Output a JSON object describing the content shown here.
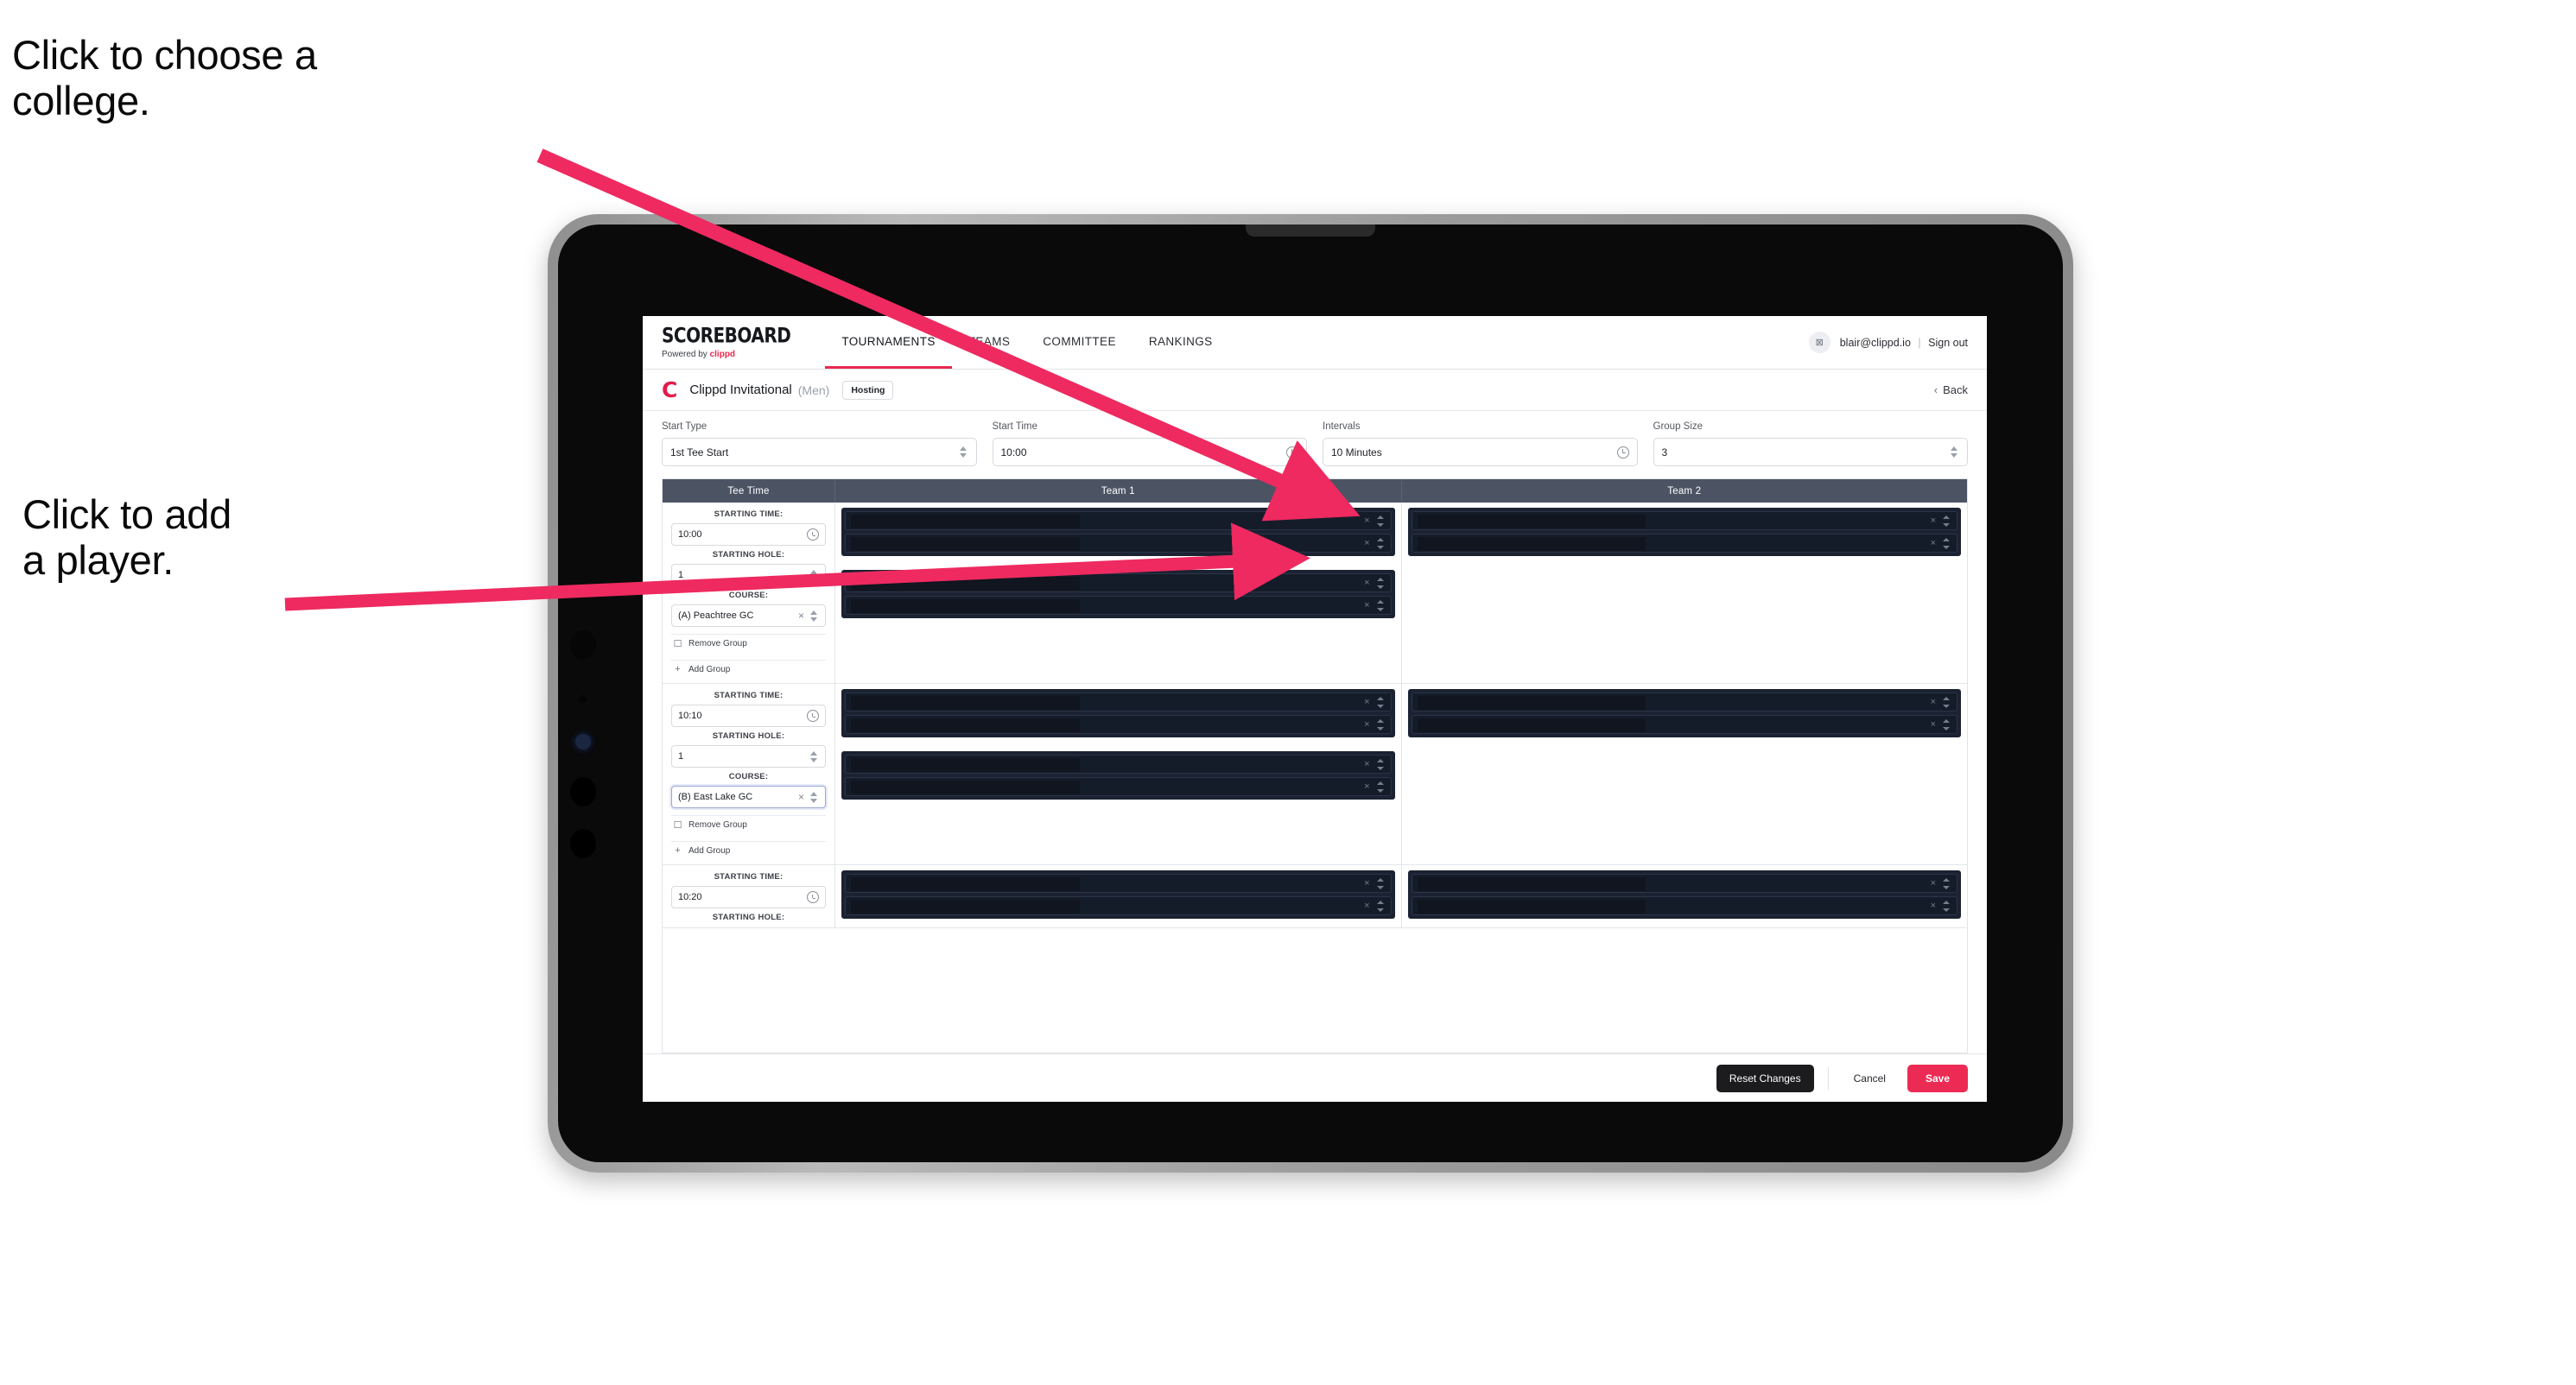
{
  "annotations": [
    {
      "id": "choose-college",
      "text": "Click to choose a\ncollege."
    },
    {
      "id": "add-player",
      "text": "Click to add\na player."
    }
  ],
  "colors": {
    "accent_pink": "#ec2b54",
    "arrow_pink": "#ee2a60",
    "table_header": "#4c5464",
    "redact_dark": "#1b2232",
    "bezel_silver": "#9b9b9b"
  },
  "nav": {
    "brand_title": "SCOREBOARD",
    "brand_sub_prefix": "Powered by",
    "brand_sub_name": "clippd",
    "links": [
      {
        "label": "TOURNAMENTS",
        "active": true
      },
      {
        "label": "TEAMS",
        "active": false
      },
      {
        "label": "COMMITTEE",
        "active": false
      },
      {
        "label": "RANKINGS",
        "active": false
      }
    ],
    "avatar_glyph": "⊠",
    "user_email": "blair@clippd.io",
    "separator": "|",
    "sign_out": "Sign out"
  },
  "tournament": {
    "logo_letter": "C",
    "name": "Clippd Invitational",
    "gender": "(Men)",
    "badge": "Hosting",
    "back_chevron": "‹",
    "back_label": "Back"
  },
  "controls": [
    {
      "label": "Start Type",
      "value": "1st Tee Start",
      "adorn": "stepper"
    },
    {
      "label": "Start Time",
      "value": "10:00",
      "adorn": "clock"
    },
    {
      "label": "Intervals",
      "value": "10 Minutes",
      "adorn": "clock"
    },
    {
      "label": "Group Size",
      "value": "3",
      "adorn": "stepper"
    }
  ],
  "table": {
    "headers": [
      "Tee Time",
      "Team 1",
      "Team 2"
    ],
    "field_labels": {
      "starting_time": "STARTING TIME:",
      "starting_hole": "STARTING HOLE:",
      "course": "COURSE:"
    },
    "group_actions": {
      "remove": "Remove Group",
      "remove_icon": "☐",
      "add": "Add Group",
      "add_icon": "+"
    },
    "clear_icon": "×",
    "groups": [
      {
        "starting_time": "10:00",
        "starting_hole": "1",
        "course": "(A) Peachtree GC",
        "course_focused": false,
        "team1_rows": 2,
        "team2_rows": 2,
        "extra_team1_rows": 2,
        "extra_team2_rows": 0
      },
      {
        "starting_time": "10:10",
        "starting_hole": "1",
        "course": "(B) East Lake GC",
        "course_focused": true,
        "team1_rows": 2,
        "team2_rows": 2,
        "extra_team1_rows": 2,
        "extra_team2_rows": 0
      },
      {
        "starting_time": "10:20",
        "starting_hole": "",
        "course": "",
        "course_focused": false,
        "team1_rows": 2,
        "team2_rows": 2,
        "extra_team1_rows": 0,
        "extra_team2_rows": 0
      }
    ]
  },
  "footer": {
    "reset": "Reset Changes",
    "cancel": "Cancel",
    "save": "Save"
  }
}
